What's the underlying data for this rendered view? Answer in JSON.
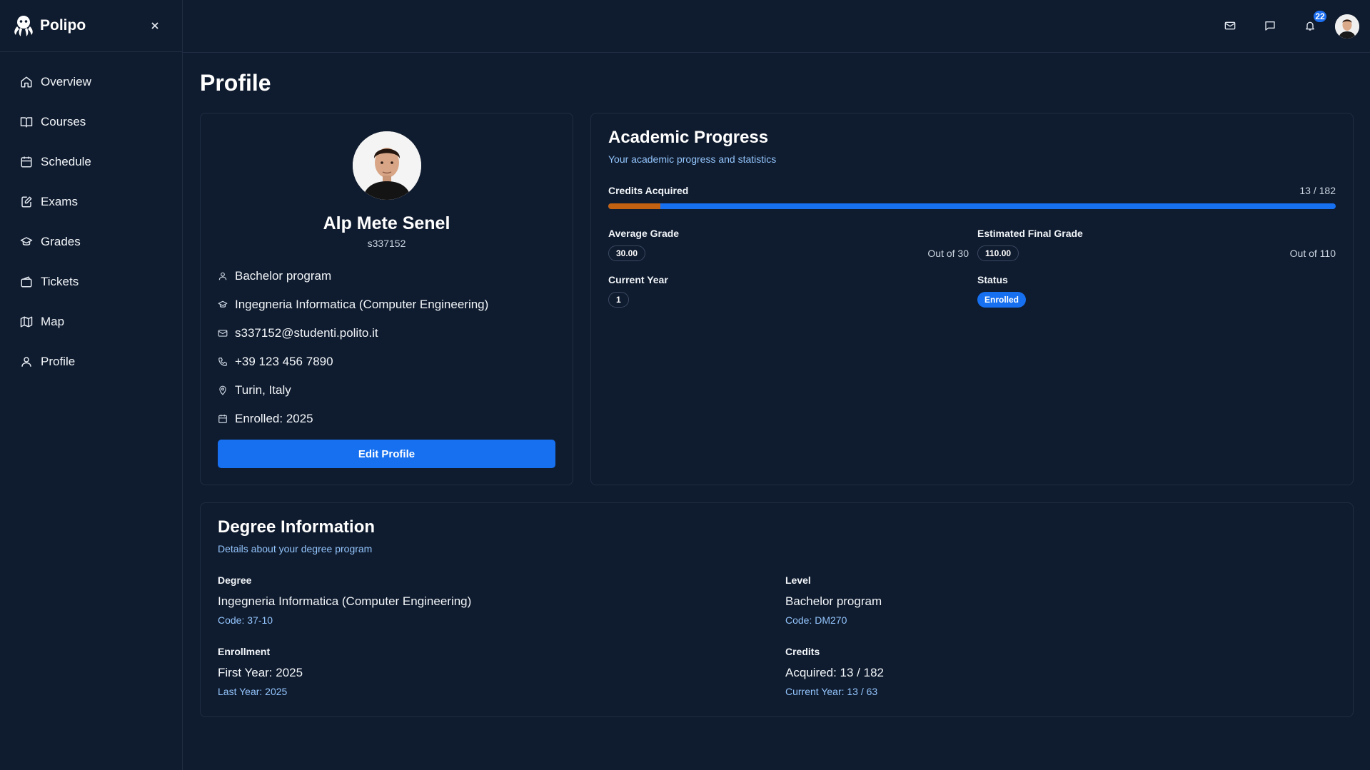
{
  "app": {
    "name": "Polipo"
  },
  "sidebar": {
    "items": [
      {
        "label": "Overview",
        "icon": "home-icon"
      },
      {
        "label": "Courses",
        "icon": "book-icon"
      },
      {
        "label": "Schedule",
        "icon": "calendar-icon"
      },
      {
        "label": "Exams",
        "icon": "edit-document-icon"
      },
      {
        "label": "Grades",
        "icon": "graduation-cap-icon"
      },
      {
        "label": "Tickets",
        "icon": "ticket-icon"
      },
      {
        "label": "Map",
        "icon": "map-icon"
      },
      {
        "label": "Profile",
        "icon": "user-icon"
      }
    ]
  },
  "topbar": {
    "notification_count": "22"
  },
  "page": {
    "title": "Profile"
  },
  "profile": {
    "name": "Alp Mete Senel",
    "student_id": "s337152",
    "program": "Bachelor program",
    "course": "Ingegneria Informatica (Computer Engineering)",
    "email": "s337152@studenti.polito.it",
    "phone": "+39 123 456 7890",
    "location": "Turin, Italy",
    "enrolled": "Enrolled: 2025",
    "edit_label": "Edit Profile"
  },
  "progress": {
    "title": "Academic Progress",
    "subtitle": "Your academic progress and statistics",
    "credits_label": "Credits Acquired",
    "credits_value": "13 / 182",
    "credits_fraction": 0.0714,
    "avg_label": "Average Grade",
    "avg_value": "30.00",
    "avg_out_of": "Out of 30",
    "final_label": "Estimated Final Grade",
    "final_value": "110.00",
    "final_out_of": "Out of 110",
    "year_label": "Current Year",
    "year_value": "1",
    "status_label": "Status",
    "status_value": "Enrolled"
  },
  "degree": {
    "title": "Degree Information",
    "subtitle": "Details about your degree program",
    "degree_label": "Degree",
    "degree_value": "Ingegneria Informatica (Computer Engineering)",
    "degree_code": "Code: 37-10",
    "level_label": "Level",
    "level_value": "Bachelor program",
    "level_code": "Code: DM270",
    "enrollment_label": "Enrollment",
    "enrollment_first": "First Year: 2025",
    "enrollment_last": "Last Year: 2025",
    "credits_label": "Credits",
    "credits_acquired": "Acquired: 13 / 182",
    "credits_current": "Current Year: 13 / 63"
  },
  "colors": {
    "background": "#0f1b2e",
    "accent": "#1670f0",
    "progress_fill": "#c2610f",
    "subtle_text": "#93c5fd"
  }
}
